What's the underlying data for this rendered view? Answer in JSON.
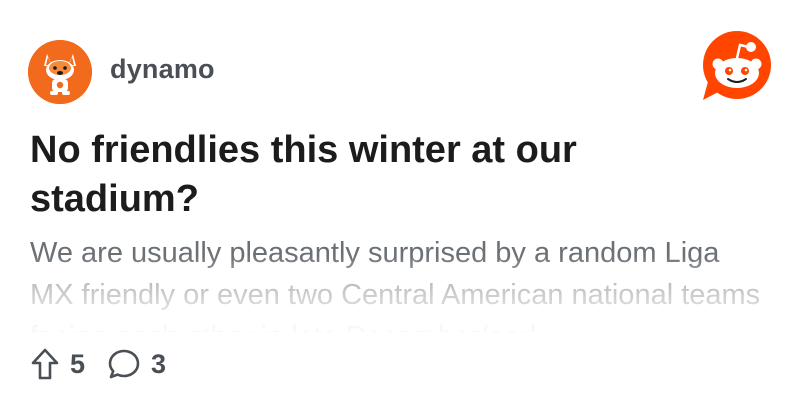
{
  "post": {
    "author": "dynamo",
    "title": "No friendlies this winter at our stadium?",
    "body": "We are usually pleasantly surprised by a random Liga MX friendly or even two Central American national teams facing each other in late December/early ...",
    "upvotes": "5",
    "comments": "3"
  },
  "icons": {
    "avatar": "orange-fox-mascot-icon",
    "brand_logo": "reddit-snoo-icon",
    "upvote": "upvote-arrow-icon",
    "comment": "comment-bubble-icon"
  },
  "colors": {
    "brand": "#ff4500",
    "avatar_bg": "#f26a1b",
    "title": "#1c1c1c",
    "meta": "#4a4f55",
    "body": "#6b7075"
  }
}
